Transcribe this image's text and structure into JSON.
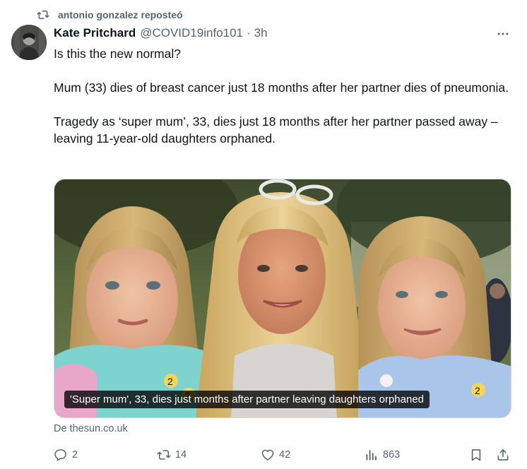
{
  "repost_banner": {
    "text": "antonio gonzalez reposteó",
    "icon": "repost-icon"
  },
  "author": {
    "name": "Kate Pritchard",
    "handle": "@COVID19info101",
    "separator": "·",
    "time": "3h",
    "avatar_icon": "avatar"
  },
  "tweet": {
    "paragraphs": [
      "Is this the new normal?",
      "Mum (33) dies of breast cancer just 18 months after her partner dies of pneumonia.",
      "Tragedy as ‘super mum’, 33, dies just 18 months after her partner passed away – leaving 11-year-old daughters orphaned."
    ]
  },
  "link_card": {
    "caption": "'Super mum', 33, dies just months after partner leaving daughters orphaned",
    "source": "De thesun.co.uk"
  },
  "actions": {
    "reply_count": "2",
    "repost_count": "14",
    "like_count": "42",
    "view_count": "863"
  },
  "icons": [
    "repost-icon",
    "more-icon",
    "reply-icon",
    "retweet-icon",
    "like-icon",
    "views-icon",
    "bookmark-icon",
    "share-icon"
  ],
  "colors": {
    "text": "#0f1419",
    "secondary": "#536471",
    "border": "#cfd9de"
  }
}
